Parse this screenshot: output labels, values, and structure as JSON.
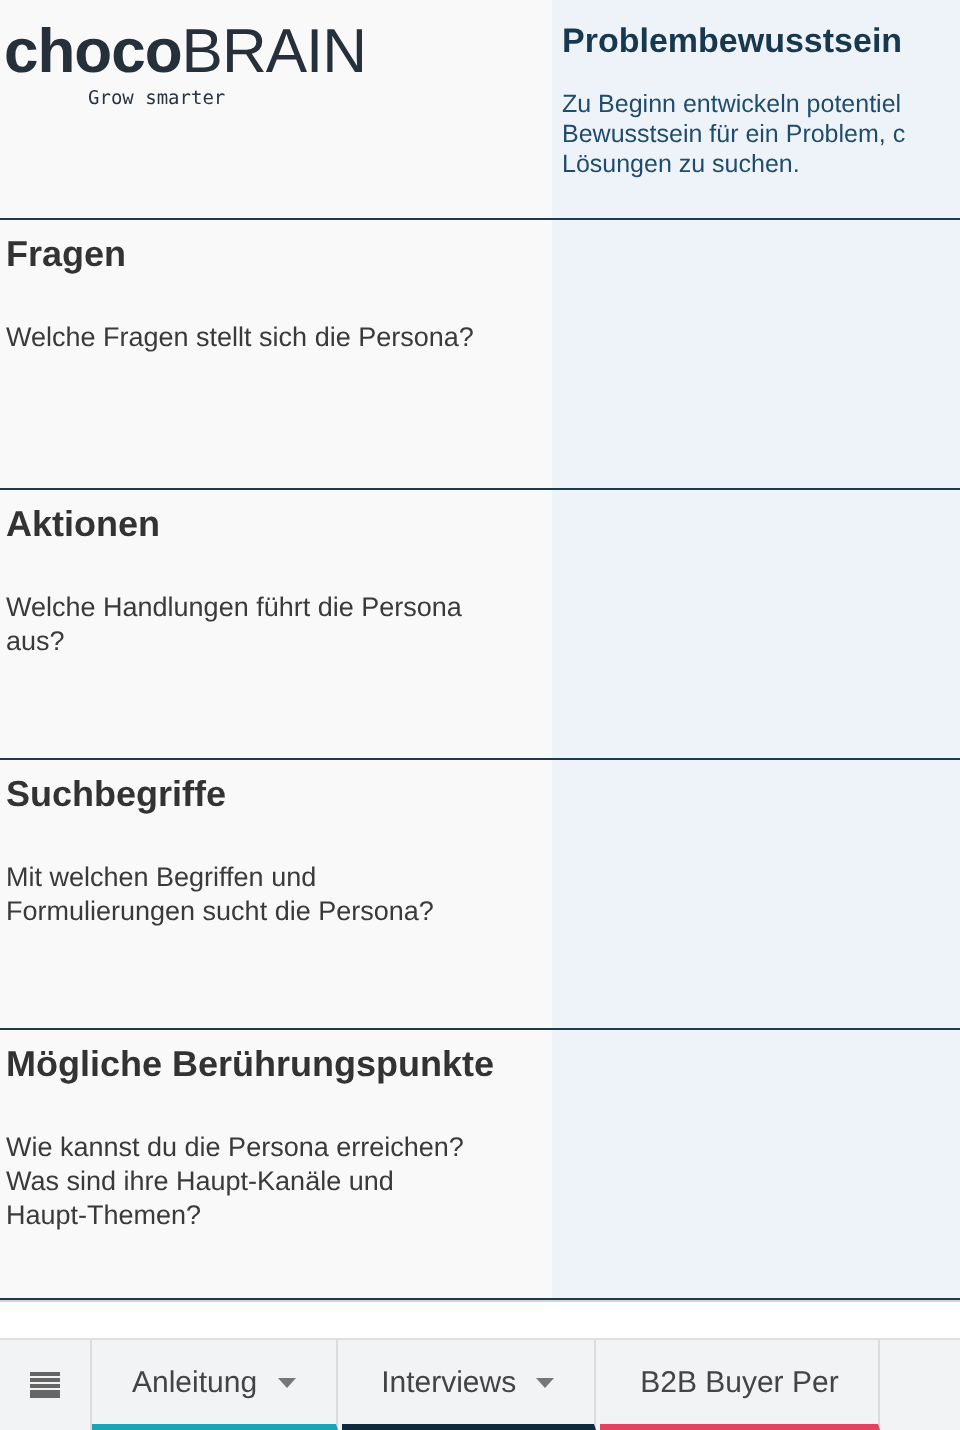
{
  "logo": {
    "wordmark": "**choco**BRAIN",
    "tagline": "Grow smarter"
  },
  "stage": {
    "title": "Problembewusstsein",
    "description": "Zu Beginn entwickeln potentiel\nBewusstsein für ein Problem, c\nLösungen zu suchen."
  },
  "rows": [
    {
      "title": "Fragen",
      "question": "Welche Fragen stellt sich die Persona?"
    },
    {
      "title": "Aktionen",
      "question": "Welche Handlungen führt die Persona\naus?"
    },
    {
      "title": "Suchbegriffe",
      "question": "Mit welchen Begriffen und\nFormulierungen sucht die Persona?"
    },
    {
      "title": "Mögliche Berührungspunkte",
      "question": "Wie kannst du die Persona erreichen?\nWas sind ihre Haupt-Kanäle und\nHaupt-Themen?"
    }
  ],
  "sheet_tabs": [
    {
      "label": "Anleitung",
      "color": "#1ba3b6",
      "dropdown": true
    },
    {
      "label": "Interviews",
      "color": "#0f2b3b",
      "dropdown": true
    },
    {
      "label": "B2B Buyer Per",
      "color": "#e2435f",
      "dropdown": false
    }
  ]
}
